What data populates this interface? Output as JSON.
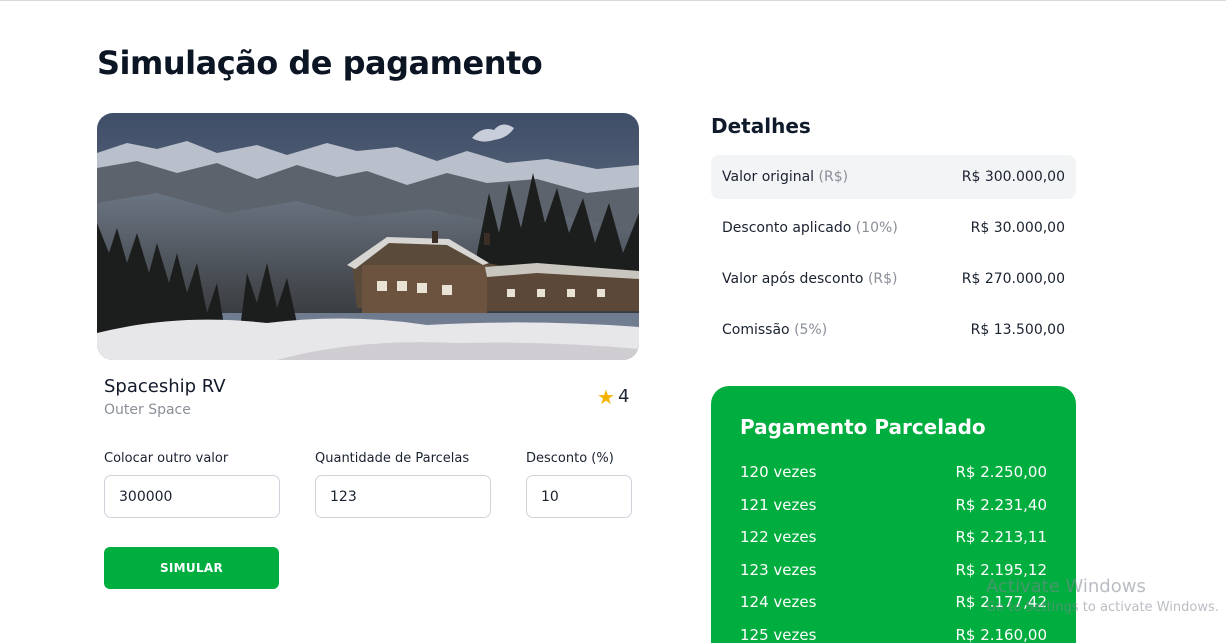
{
  "page": {
    "title": "Simulação de pagamento"
  },
  "property": {
    "name": "Spaceship RV",
    "location": "Outer Space",
    "rating": "4",
    "image": "mountain-chalet-photo"
  },
  "form": {
    "value_label": "Colocar outro valor",
    "value": "300000",
    "installments_label": "Quantidade de Parcelas",
    "installments": "123",
    "discount_label": "Desconto (%)",
    "discount": "10",
    "submit_label": "SIMULAR"
  },
  "details": {
    "title": "Detalhes",
    "rows": [
      {
        "label": "Valor original",
        "paren": "(R$)",
        "value": "R$ 300.000,00"
      },
      {
        "label": "Desconto aplicado",
        "paren": "(10%)",
        "value": "R$ 30.000,00"
      },
      {
        "label": "Valor após desconto",
        "paren": "(R$)",
        "value": "R$ 270.000,00"
      },
      {
        "label": "Comissão",
        "paren": "(5%)",
        "value": "R$ 13.500,00"
      }
    ]
  },
  "installments_card": {
    "title": "Pagamento Parcelado",
    "rows": [
      {
        "label": "120 vezes",
        "value": "R$ 2.250,00"
      },
      {
        "label": "121 vezes",
        "value": "R$ 2.231,40"
      },
      {
        "label": "122 vezes",
        "value": "R$ 2.213,11"
      },
      {
        "label": "123 vezes",
        "value": "R$ 2.195,12"
      },
      {
        "label": "124 vezes",
        "value": "R$ 2.177,42"
      },
      {
        "label": "125 vezes",
        "value": "R$ 2.160,00"
      }
    ]
  },
  "watermark": {
    "line1": "Activate Windows",
    "line2": "Go to Settings to activate Windows."
  },
  "colors": {
    "accent": "#00ad3f",
    "text": "#0f1a2a",
    "muted": "#8a8f98",
    "star": "#f5b301"
  },
  "icons": {
    "rating": "star-icon"
  }
}
